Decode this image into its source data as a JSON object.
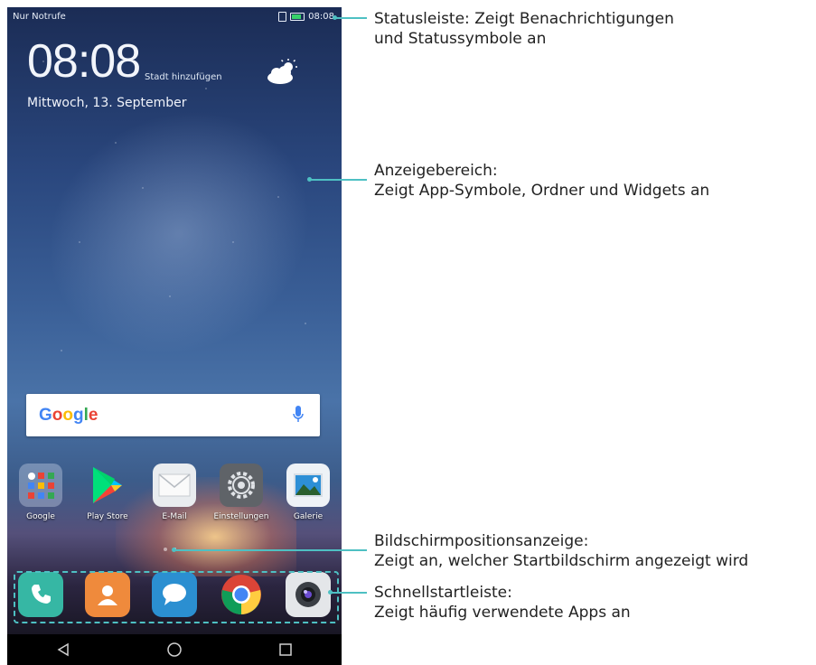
{
  "status_bar": {
    "carrier": "Nur Notrufe",
    "time": "08:08",
    "battery_color": "#37d26a"
  },
  "lockclock": {
    "time": "08:08",
    "add_city": "Stadt hinzufügen",
    "date": "Mittwoch, 13. September"
  },
  "search": {
    "logo": "Google",
    "icon": "mic-icon"
  },
  "apps": [
    {
      "label": "Google",
      "icon": "folder-icon"
    },
    {
      "label": "Play Store",
      "icon": "play-store-icon"
    },
    {
      "label": "E-Mail",
      "icon": "mail-icon"
    },
    {
      "label": "Einstellungen",
      "icon": "settings-icon"
    },
    {
      "label": "Galerie",
      "icon": "gallery-icon"
    }
  ],
  "page_indicator": {
    "pages": 2,
    "active": 1
  },
  "dock": [
    {
      "icon": "phone-icon"
    },
    {
      "icon": "contacts-icon"
    },
    {
      "icon": "messages-icon"
    },
    {
      "icon": "chrome-icon"
    },
    {
      "icon": "camera-icon"
    }
  ],
  "navbar": {
    "icons": [
      "back-icon",
      "home-icon",
      "recents-icon"
    ]
  },
  "annotations": [
    {
      "line1": "Statusleiste: Zeigt Benachrichtigungen",
      "line2": "und Statussymbole an"
    },
    {
      "line1": "Anzeigebereich:",
      "line2": "Zeigt App-Symbole, Ordner und Widgets an"
    },
    {
      "line1": "Bildschirmpositionsanzeige:",
      "line2": "Zeigt an, welcher Startbildschirm angezeigt wird"
    },
    {
      "line1": "Schnellstartleiste:",
      "line2": "Zeigt häufig verwendete Apps an"
    }
  ],
  "accent_color": "#4ec0c3"
}
